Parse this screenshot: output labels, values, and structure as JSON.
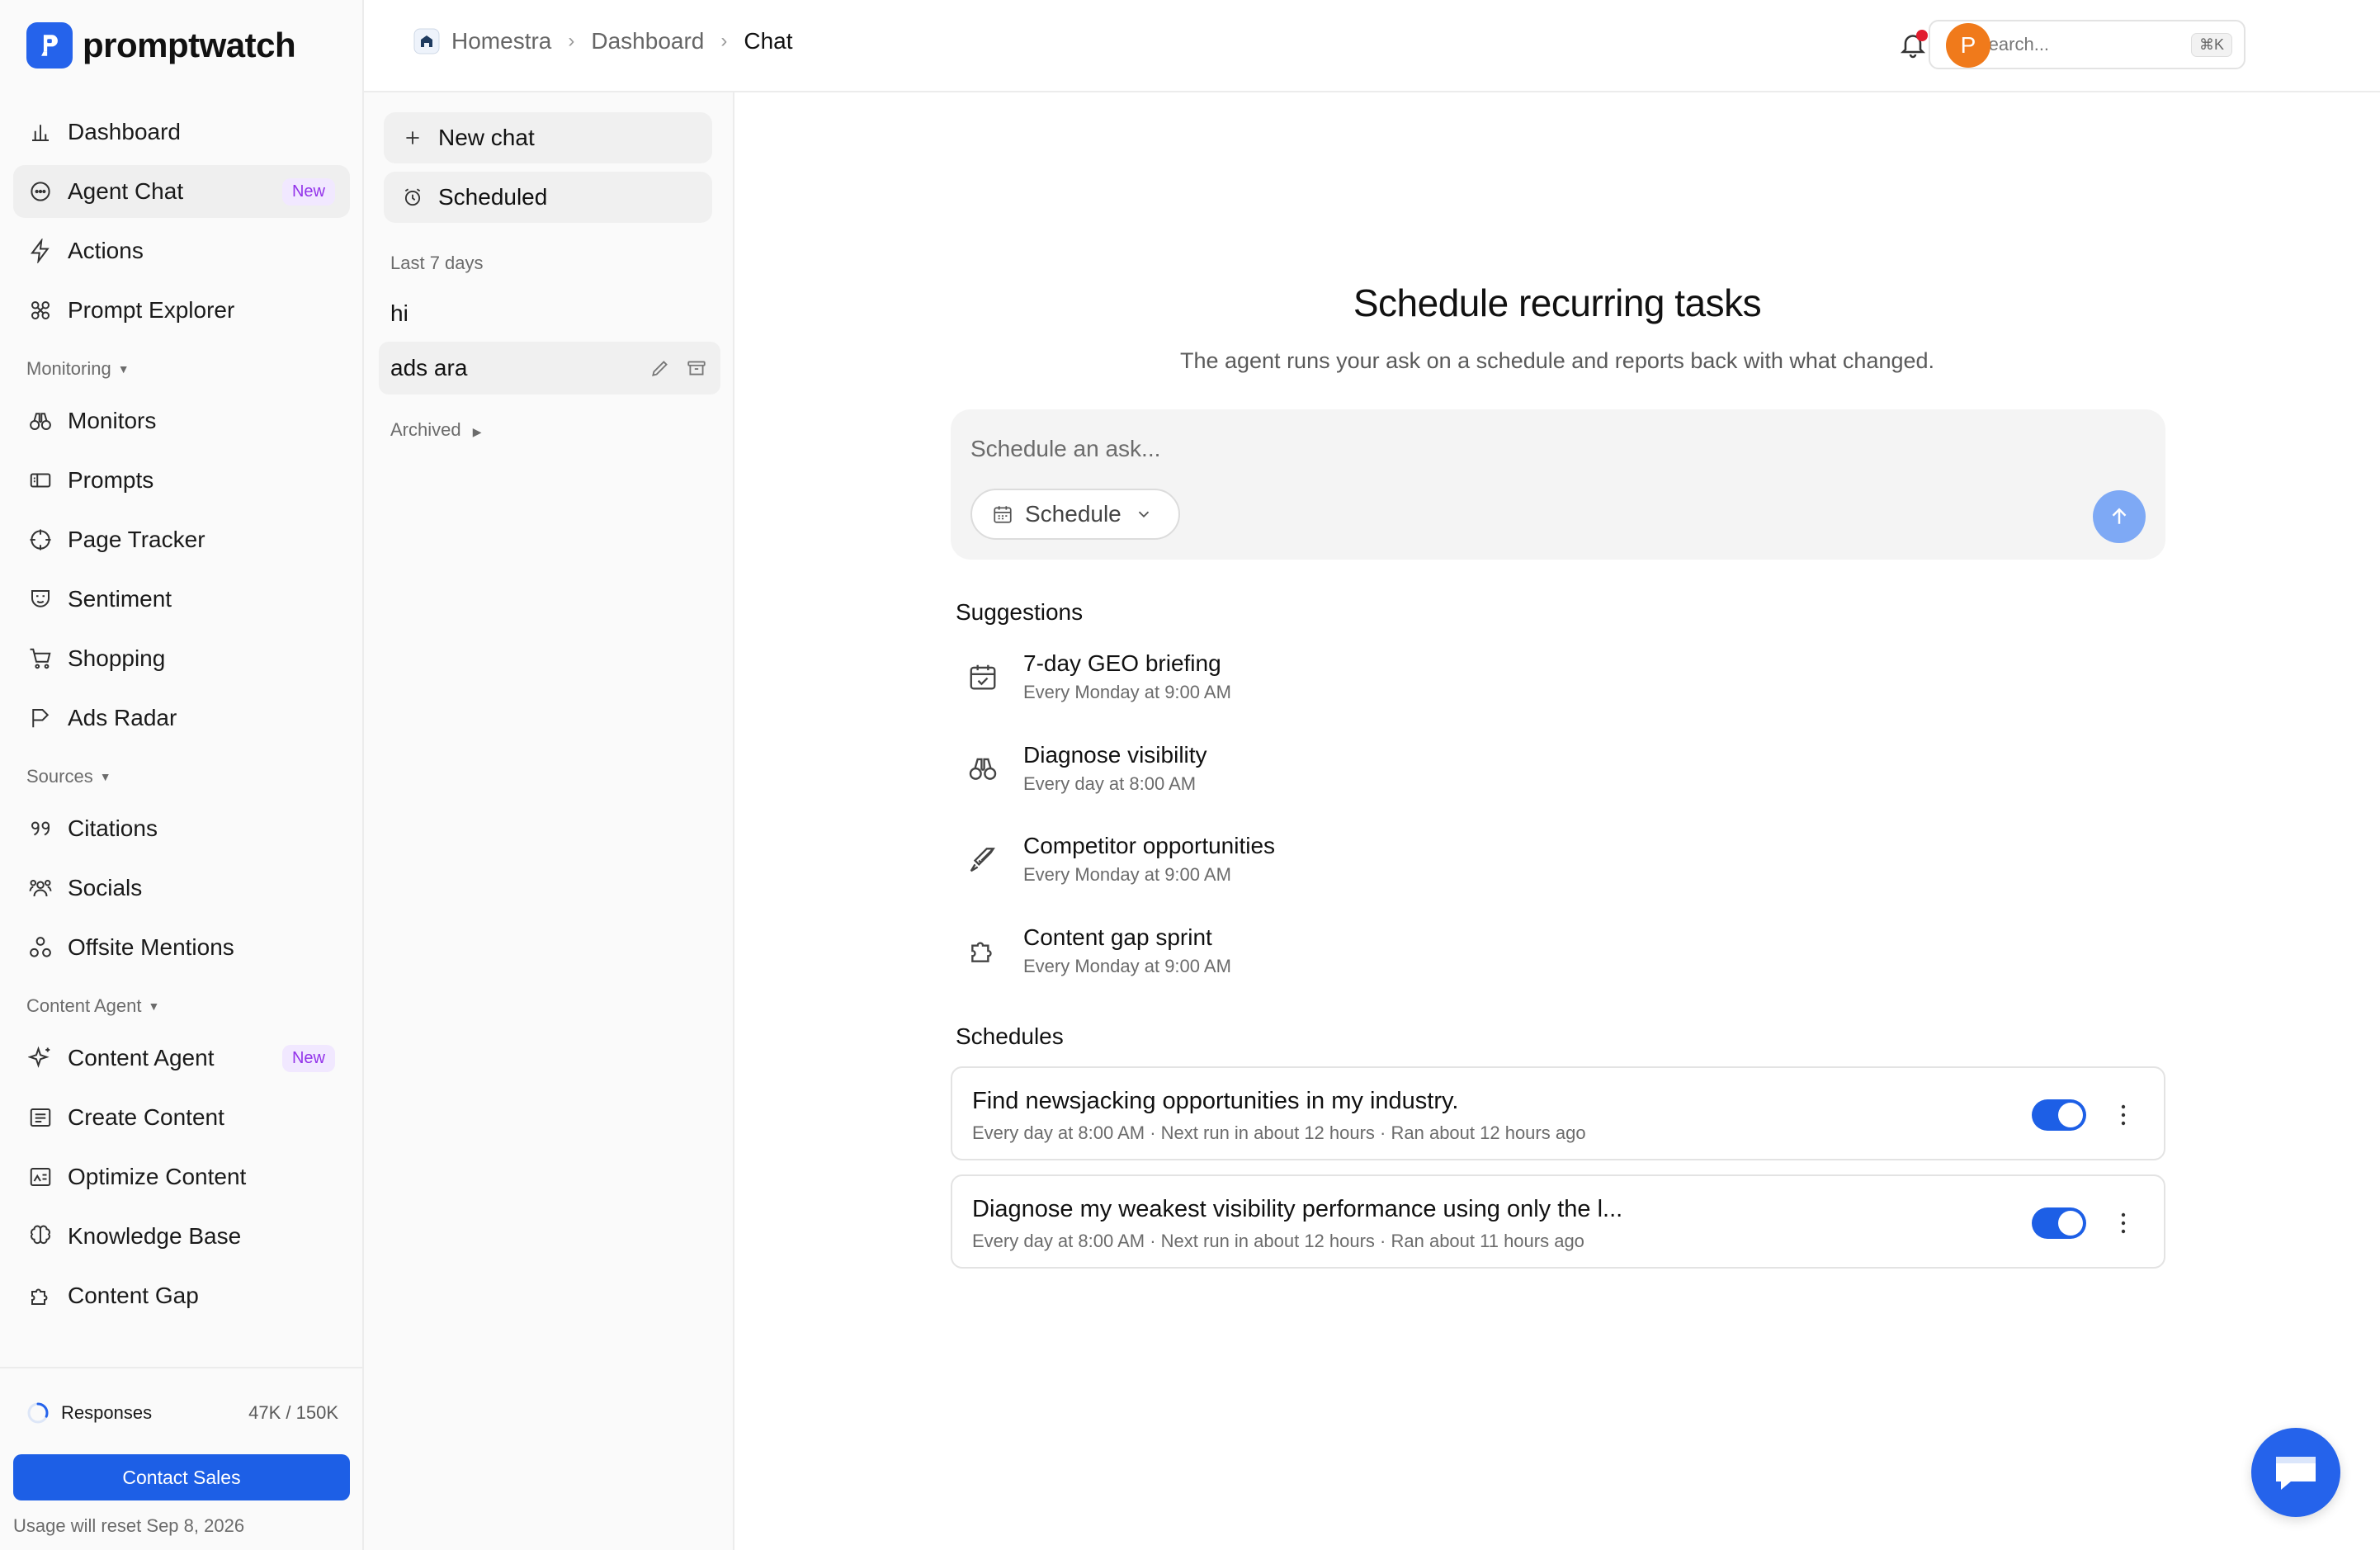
{
  "brand": {
    "name": "promptwatch",
    "color": "#2563eb"
  },
  "nav": {
    "top": [
      {
        "label": "Dashboard",
        "icon": "bar-chart-icon"
      },
      {
        "label": "Agent Chat",
        "icon": "chat-bubble-icon",
        "badge": "New",
        "active": true
      },
      {
        "label": "Actions",
        "icon": "lightning-icon"
      },
      {
        "label": "Prompt Explorer",
        "icon": "compass-icon"
      }
    ],
    "monitoring_label": "Monitoring",
    "monitoring": [
      {
        "label": "Monitors",
        "icon": "binoculars-icon"
      },
      {
        "label": "Prompts",
        "icon": "prompt-icon"
      },
      {
        "label": "Page Tracker",
        "icon": "target-icon"
      },
      {
        "label": "Sentiment",
        "icon": "mask-icon"
      },
      {
        "label": "Shopping",
        "icon": "cart-icon"
      },
      {
        "label": "Ads Radar",
        "icon": "flag-icon"
      }
    ],
    "sources_label": "Sources",
    "sources": [
      {
        "label": "Citations",
        "icon": "quote-icon"
      },
      {
        "label": "Socials",
        "icon": "people-icon"
      },
      {
        "label": "Offsite Mentions",
        "icon": "nodes-icon"
      }
    ],
    "content_label": "Content Agent",
    "content": [
      {
        "label": "Content Agent",
        "icon": "sparkle-icon",
        "badge": "New"
      },
      {
        "label": "Create Content",
        "icon": "document-icon"
      },
      {
        "label": "Optimize Content",
        "icon": "image-text-icon"
      },
      {
        "label": "Knowledge Base",
        "icon": "brain-icon"
      },
      {
        "label": "Content Gap",
        "icon": "puzzle-icon"
      }
    ]
  },
  "usage": {
    "label": "Responses",
    "count": "47K / 150K",
    "progress": 0.31,
    "contact": "Contact Sales",
    "reset": "Usage will reset Sep 8, 2026"
  },
  "breadcrumb": {
    "project": "Homestra",
    "section": "Dashboard",
    "current": "Chat"
  },
  "search": {
    "placeholder": "Search...",
    "shortcut": "⌘K"
  },
  "user": {
    "initial": "P",
    "color": "#f07a1b"
  },
  "chatlist": {
    "new_chat": "New chat",
    "scheduled": "Scheduled",
    "group_label": "Last 7 days",
    "items": [
      "hi",
      "ads ara"
    ],
    "archived": "Archived"
  },
  "main": {
    "title": "Schedule recurring tasks",
    "subtitle": "The agent runs your ask on a schedule and reports back with what changed.",
    "composer_placeholder": "Schedule an ask...",
    "schedule_button": "Schedule",
    "suggestions_label": "Suggestions",
    "suggestions": [
      {
        "title": "7-day GEO briefing",
        "sub": "Every Monday at 9:00 AM",
        "icon": "calendar-check-icon"
      },
      {
        "title": "Diagnose visibility",
        "sub": "Every day at 8:00 AM",
        "icon": "binoculars-icon"
      },
      {
        "title": "Competitor opportunities",
        "sub": "Every Monday at 9:00 AM",
        "icon": "sword-icon"
      },
      {
        "title": "Content gap sprint",
        "sub": "Every Monday at 9:00 AM",
        "icon": "puzzle-icon"
      }
    ],
    "schedules_label": "Schedules",
    "schedules": [
      {
        "title": "Find newsjacking opportunities in my industry.",
        "meta": "Every day at 8:00 AM · Next run in about 12 hours · Ran about 12 hours ago",
        "enabled": true
      },
      {
        "title": "Diagnose my weakest visibility performance using only the l...",
        "meta": "Every day at 8:00 AM · Next run in about 12 hours · Ran about 11 hours ago",
        "enabled": true
      }
    ]
  }
}
